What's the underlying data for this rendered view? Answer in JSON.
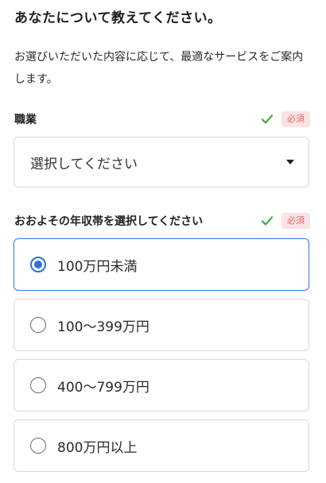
{
  "heading": "あなたについて教えてください。",
  "intro": "お選びいただいた内容に応じて、最適なサービスをご案内します。",
  "occupation": {
    "label": "職業",
    "required_badge": "必須",
    "status_icon": "check-icon",
    "select_value": "選択してください"
  },
  "income": {
    "label": "おおよその年収帯を選択してください",
    "required_badge": "必須",
    "status_icon": "check-icon",
    "options": [
      {
        "label": "100万円未満",
        "selected": true
      },
      {
        "label": "100〜399万円",
        "selected": false
      },
      {
        "label": "400〜799万円",
        "selected": false
      },
      {
        "label": "800万円以上",
        "selected": false
      }
    ]
  },
  "colors": {
    "accent": "#2f6fe0",
    "check": "#4caf50",
    "required_bg": "#fbe3e3",
    "required_text": "#e56b6b"
  }
}
